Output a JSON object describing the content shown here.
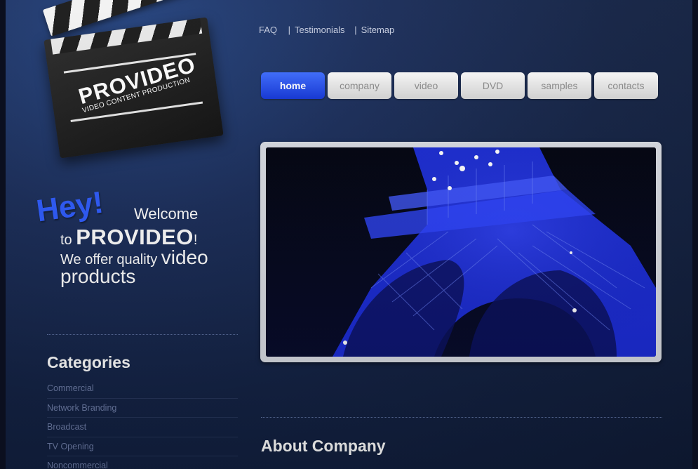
{
  "logo": {
    "brand": "PROVIDEO",
    "tagline": "VIDEO CONTENT PRODUCTION"
  },
  "top_links": [
    "FAQ",
    "Testimonials",
    "Sitemap"
  ],
  "nav": {
    "tabs": [
      "home",
      "company",
      "video",
      "DVD",
      "samples",
      "contacts"
    ],
    "active": "home"
  },
  "welcome": {
    "hey": "Hey!",
    "line1": "Welcome",
    "line2_prefix": "to ",
    "line2_brand": "PROVIDEO",
    "line2_suffix": "!",
    "line3_prefix": "We offer quality ",
    "line3_big": "video",
    "line4": "products"
  },
  "categories": {
    "title": "Categories",
    "items": [
      "Commercial",
      "Network Branding",
      "Broadcast",
      "TV Opening",
      "Noncommercial"
    ]
  },
  "about": {
    "title": "About Company"
  },
  "colors": {
    "accent": "#2e5cff",
    "nav_active": "#1336d8",
    "background": "#132244"
  }
}
